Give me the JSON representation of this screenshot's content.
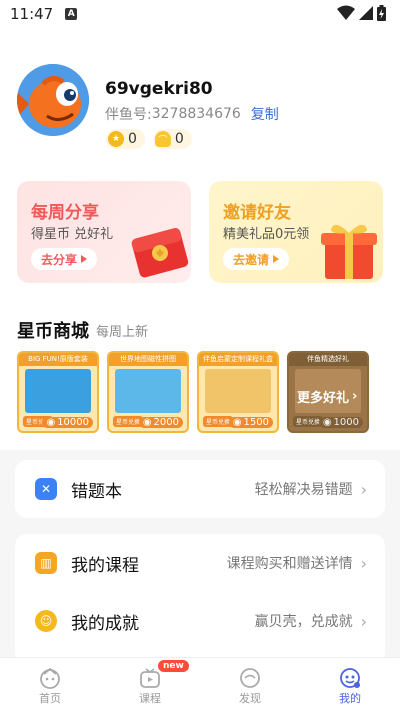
{
  "status": {
    "time": "11:47",
    "a_badge": "A"
  },
  "profile": {
    "username": "69vgekri80",
    "uid_label": "伴鱼号: ",
    "uid_value": "3278834676",
    "copy_label": "复制",
    "star_coins": "0",
    "shells": "0"
  },
  "promo": {
    "share": {
      "title": "每周分享",
      "subtitle": "得星币 兑好礼",
      "button": "去分享"
    },
    "invite": {
      "title": "邀请好友",
      "subtitle": "精美礼品0元领",
      "button": "去邀请"
    }
  },
  "mall": {
    "title": "星币商城",
    "subtitle": "每周上新",
    "products": [
      {
        "title": "BIG FUN!原版套装",
        "label": "星币兑换",
        "price": "10000",
        "img_color": "#3aa0e0"
      },
      {
        "title": "世界地图磁性拼图",
        "label": "星币兑换",
        "price": "2000",
        "img_color": "#5bb8e8"
      },
      {
        "title": "伴鱼启蒙定制课程礼盒",
        "label": "星币兑换",
        "price": "1500",
        "img_color": "#f2c46a"
      },
      {
        "title": "伴鱼精选好礼",
        "label": "星币兑换",
        "price": "1000",
        "img_color": "#b48a5a",
        "more_label": "更多好礼"
      }
    ]
  },
  "list1": [
    {
      "label": "错题本",
      "hint": "轻松解决易错题",
      "icon": "mistake-book-icon",
      "color": "#3b82f6"
    }
  ],
  "list2": [
    {
      "label": "我的课程",
      "hint": "课程购买和赠送详情",
      "icon": "course-icon",
      "color": "#f5a623"
    },
    {
      "label": "我的成就",
      "hint": "赢贝壳，兑成就",
      "icon": "achievement-icon",
      "color": "#f5b91d"
    }
  ],
  "nav": [
    {
      "label": "首页",
      "icon": "home-icon"
    },
    {
      "label": "课程",
      "icon": "course-tv-icon",
      "badge": "new"
    },
    {
      "label": "发现",
      "icon": "discover-icon"
    },
    {
      "label": "我的",
      "icon": "profile-icon"
    }
  ],
  "colors": {
    "accent": "#4a63e0",
    "share_red": "#f05a5a",
    "invite_orange": "#f0a020",
    "coin_gold": "#f5b91d"
  }
}
